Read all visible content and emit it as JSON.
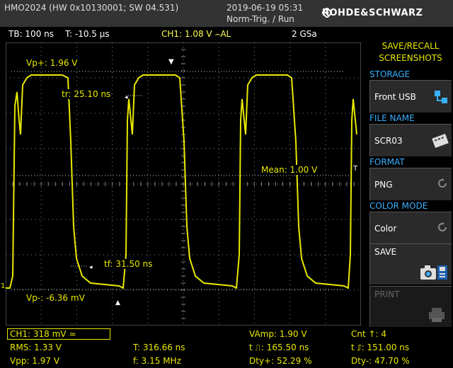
{
  "header": {
    "model": "HMO2024 (HW 0x10130001; SW 04.531)",
    "datetime": "2019-06-19 05:31",
    "trigger_state": "Norm-Trig. / Run",
    "brand": "ROHDE&SCHWARZ"
  },
  "status": {
    "timebase": "TB: 100 ns",
    "trigger_time": "T: -10.5 µs",
    "channel_trigger": "CH1: 1.08 V ⌢AL",
    "sample_rate": "2 GSa"
  },
  "annotations": {
    "vp_plus": "Vp+: 1.96 V",
    "tr": "tr: 25.10 ns",
    "mean": "Mean: 1.00 V",
    "tf": "tf: 31.50 ns",
    "vp_minus": "Vp-: -6.36 mV",
    "ch_marker": "1",
    "trig_marker": "T"
  },
  "menu": {
    "title_line1": "SAVE/RECALL",
    "title_line2": "SCREENSHOTS",
    "storage_label": "STORAGE",
    "storage_value": "Front USB",
    "file_name_label": "FILE NAME",
    "file_name_value": "SCR03",
    "format_label": "FORMAT",
    "format_value": "PNG",
    "color_mode_label": "COLOR MODE",
    "color_mode_value": "Color",
    "save_label": "SAVE",
    "print_label": "PRINT"
  },
  "measurements": {
    "ch1": "CH1: 318 mV ≃",
    "vamp": "VAmp: 1.90 V",
    "cnt": "Cnt ↑: 4",
    "rms": "RMS: 1.33 V",
    "period": "T: 316.66 ns",
    "tpos": "t ⎍: 165.50 ns",
    "tneg": "t ⎎: 151.00 ns",
    "vpp": "Vpp: 1.97 V",
    "freq": "f: 3.15 MHz",
    "dty_plus": "Dty+: 52.29 %",
    "dty_minus": "Dty-: 47.70 %"
  },
  "colors": {
    "trace": "#e8e800",
    "menu_heading": "#3ab0ff",
    "grid": "#888888",
    "topbar": "#333333"
  }
}
